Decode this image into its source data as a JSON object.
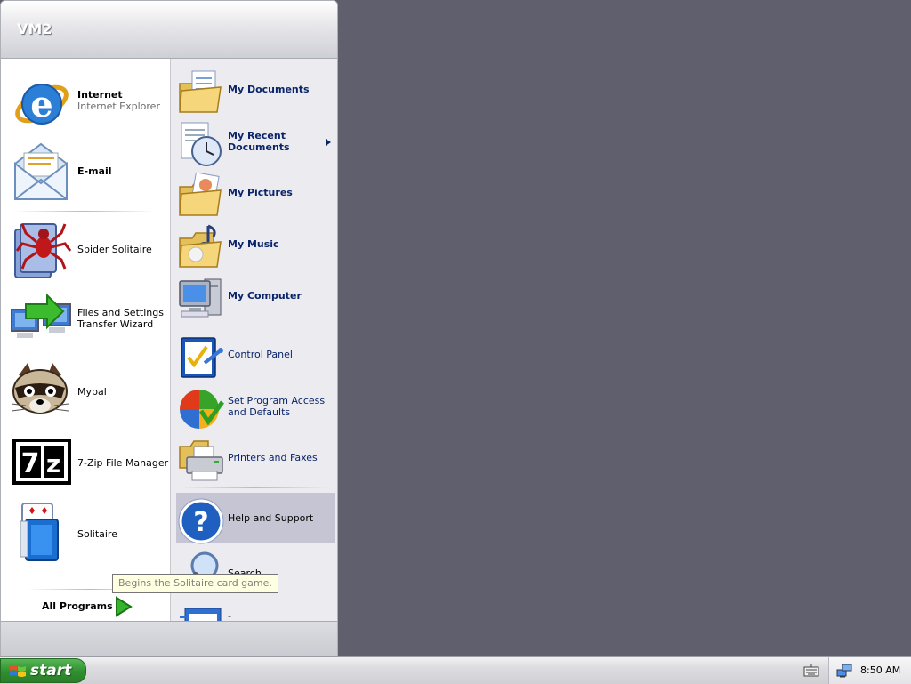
{
  "start_menu": {
    "user": "VM2",
    "left_items": [
      {
        "title": "Internet",
        "subtitle": "Internet Explorer",
        "icon": "internet-explorer-icon"
      },
      {
        "title": "E-mail",
        "icon": "email-icon"
      },
      {
        "label": "Spider Solitaire",
        "icon": "spider-solitaire-icon"
      },
      {
        "label_line1": "Files and Settings",
        "label_line2": "Transfer Wizard",
        "icon": "transfer-wizard-icon"
      },
      {
        "label": "Mypal",
        "icon": "mypal-icon"
      },
      {
        "label": "7-Zip File Manager",
        "icon": "7zip-icon",
        "icon_text": "7z"
      },
      {
        "label": "Solitaire",
        "icon": "solitaire-icon"
      }
    ],
    "all_programs": "All Programs",
    "right_items": [
      {
        "label": "My Documents",
        "icon": "my-documents-icon"
      },
      {
        "label_line1": "My Recent",
        "label_line2": "Documents",
        "icon": "my-recent-documents-icon"
      },
      {
        "label": "My Pictures",
        "icon": "my-pictures-icon"
      },
      {
        "label": "My Music",
        "icon": "my-music-icon"
      },
      {
        "label": "My Computer",
        "icon": "my-computer-icon"
      },
      {
        "label": "Control Panel",
        "icon": "control-panel-icon"
      },
      {
        "label_line1": "Set Program Access",
        "label_line2": "and Defaults",
        "icon": "set-program-access-icon"
      },
      {
        "label": "Printers and Faxes",
        "icon": "printers-faxes-icon"
      },
      {
        "label": "Help and Support",
        "icon": "help-support-icon",
        "highlighted": true
      },
      {
        "label": "Search",
        "icon": "search-icon"
      },
      {
        "label": "-",
        "icon": "run-icon"
      }
    ],
    "tooltip": "Begins the Solitaire card game."
  },
  "taskbar": {
    "start_label": "start",
    "clock": "8:50 AM"
  },
  "colors": {
    "desktop": "#5f5f6d",
    "start_green": "#2f8f2e",
    "highlight": "#c5c5d3",
    "link_blue": "#0a246a"
  }
}
